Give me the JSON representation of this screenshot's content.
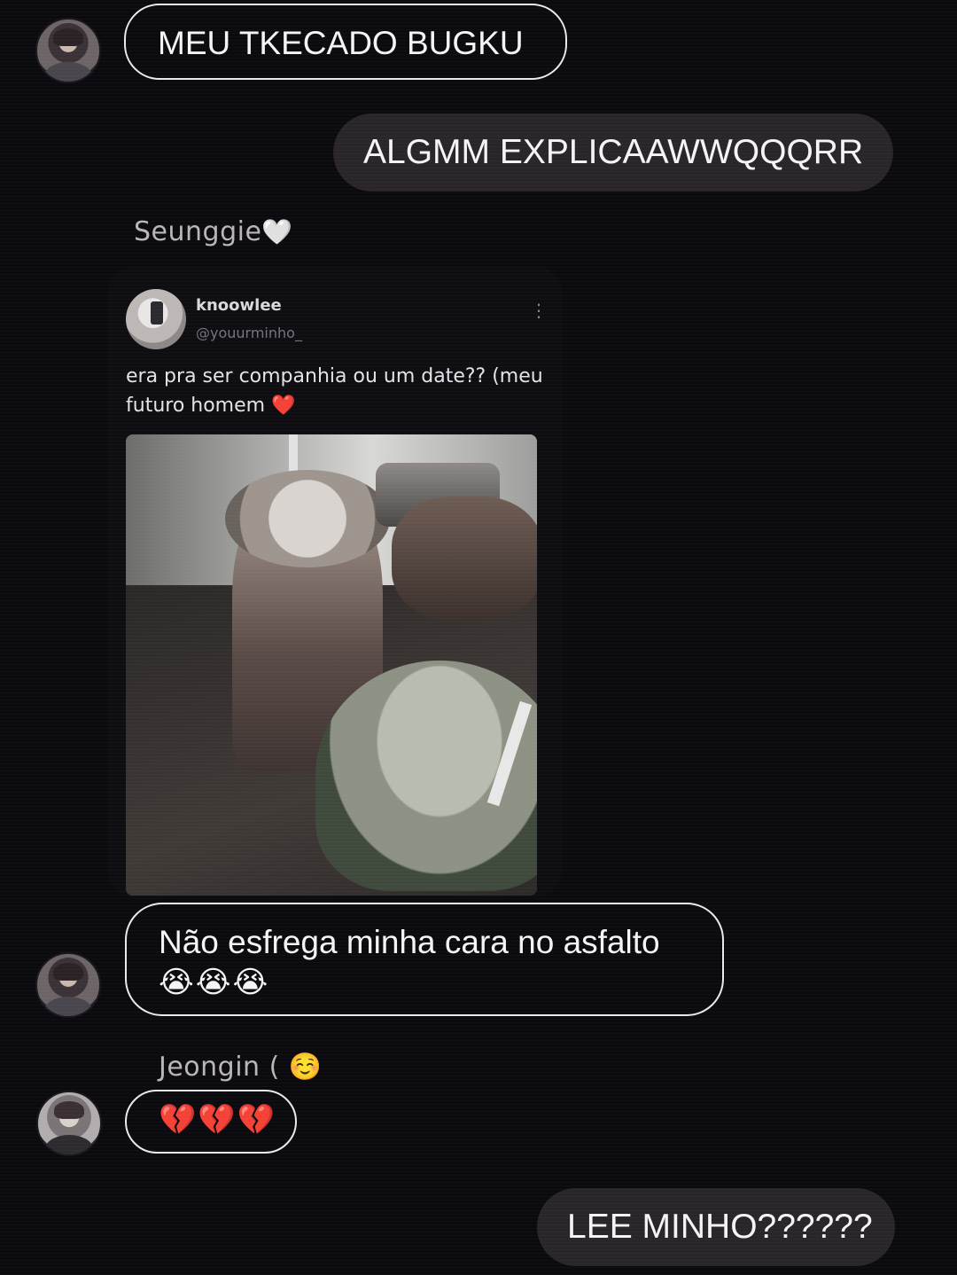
{
  "messages": {
    "m1": {
      "text": "MEU TKECADO BUGKU"
    },
    "m2": {
      "text": "ALGMM EXPLICAAWWQQQRR"
    },
    "shared_post": {
      "sender_name": "Seunggie",
      "sender_suffix": "🤍",
      "post": {
        "username": "knoowlee",
        "handle": "@youurminho_",
        "text": "era pra ser companhia ou um date?? (meu futuro homem",
        "heart": "❤️",
        "more_icon": "⋮"
      }
    },
    "m3": {
      "text": "Não esfrega minha cara no asfalto",
      "emojis": "😭😭😭"
    },
    "m4": {
      "sender_name": "Jeongin (",
      "sender_emoji": "☺️",
      "emojis": "💔💔💔"
    },
    "m5": {
      "text": "LEE MINHO??????"
    }
  }
}
